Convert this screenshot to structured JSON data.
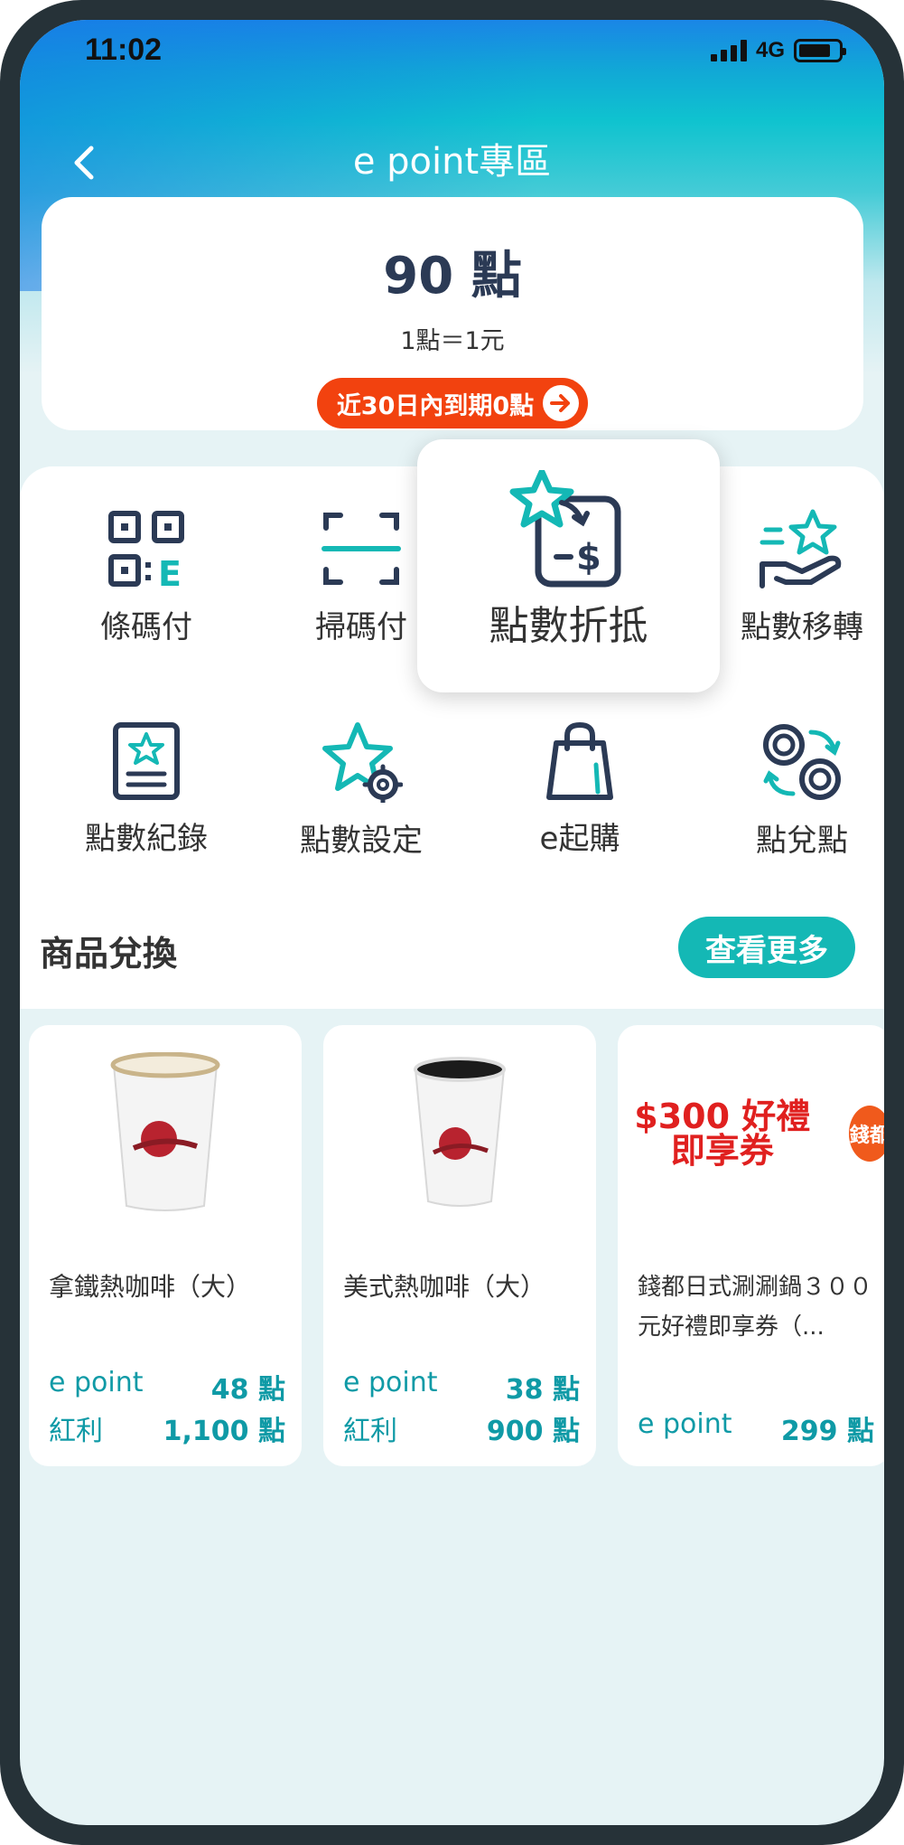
{
  "status_bar": {
    "time": "11:02",
    "network": "4G"
  },
  "header": {
    "title": "e point專區"
  },
  "points_card": {
    "balance": "90 點",
    "rate": "1點＝1元",
    "expiry_notice": "近30日內到期0點"
  },
  "menu": {
    "items": [
      {
        "label": "條碼付",
        "icon": "barcode-pay-icon"
      },
      {
        "label": "掃碼付",
        "icon": "scan-pay-icon"
      },
      {
        "label": "點數折抵",
        "icon": "points-discount-icon"
      },
      {
        "label": "點數移轉",
        "icon": "points-transfer-icon"
      },
      {
        "label": "點數紀錄",
        "icon": "points-record-icon"
      },
      {
        "label": "點數設定",
        "icon": "points-settings-icon"
      },
      {
        "label": "e起購",
        "icon": "shopping-bag-icon"
      },
      {
        "label": "點兌點",
        "icon": "points-exchange-icon"
      }
    ]
  },
  "redeem_section": {
    "title": "商品兌換",
    "more_label": "查看更多"
  },
  "products": [
    {
      "name": "拿鐵熱咖啡（大）",
      "prices": [
        {
          "type": "e point",
          "value": "48 點"
        },
        {
          "type": "紅利",
          "value": "1,100 點"
        }
      ]
    },
    {
      "name": "美式熱咖啡（大）",
      "prices": [
        {
          "type": "e point",
          "value": "38 點"
        },
        {
          "type": "紅利",
          "value": "900 點"
        }
      ]
    },
    {
      "name": "錢都日式涮涮鍋３００元好禮即享券（...",
      "image_text": "$300 好禮即享券",
      "brand_text": "錢都",
      "prices": [
        {
          "type": "e point",
          "value": "299 點"
        }
      ]
    }
  ],
  "colors": {
    "accent": "#14b8b5",
    "alert": "#f2420f",
    "navy": "#2b3a55",
    "price": "#0f9aa6"
  }
}
